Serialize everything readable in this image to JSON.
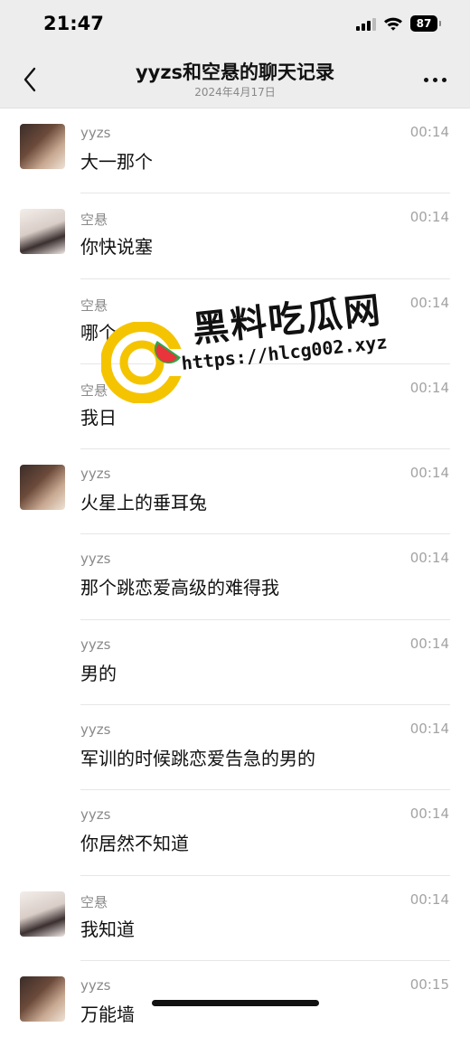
{
  "status": {
    "time": "21:47",
    "battery": "87"
  },
  "nav": {
    "title": "yyzs和空悬的聊天记录",
    "subtitle": "2024年4月17日"
  },
  "messages": [
    {
      "sender": "yyzs",
      "time": "00:14",
      "text": "大一那个",
      "avatar": "yyzs"
    },
    {
      "sender": "空悬",
      "time": "00:14",
      "text": "你快说塞",
      "avatar": "kongxuan"
    },
    {
      "sender": "空悬",
      "time": "00:14",
      "text": "哪个",
      "avatar": ""
    },
    {
      "sender": "空悬",
      "time": "00:14",
      "text": "我日",
      "avatar": ""
    },
    {
      "sender": "yyzs",
      "time": "00:14",
      "text": "火星上的垂耳兔",
      "avatar": "yyzs"
    },
    {
      "sender": "yyzs",
      "time": "00:14",
      "text": "那个跳恋爱高级的难得我",
      "avatar": ""
    },
    {
      "sender": "yyzs",
      "time": "00:14",
      "text": "男的",
      "avatar": ""
    },
    {
      "sender": "yyzs",
      "time": "00:14",
      "text": "军训的时候跳恋爱告急的男的",
      "avatar": ""
    },
    {
      "sender": "yyzs",
      "time": "00:14",
      "text": "你居然不知道",
      "avatar": ""
    },
    {
      "sender": "空悬",
      "time": "00:14",
      "text": "我知道",
      "avatar": "kongxuan"
    },
    {
      "sender": "yyzs",
      "time": "00:15",
      "text": "万能墙",
      "avatar": "yyzs"
    }
  ],
  "watermark": {
    "title": "黑料吃瓜网",
    "url": "https://hlcg002.xyz"
  },
  "colors": {
    "header_bg": "#ededed",
    "divider": "#e6e6e6",
    "timestamp": "#a3a3a3",
    "watermark_yellow": "#f5c400",
    "watermark_red": "#e8343a",
    "watermark_green": "#2aa84a"
  },
  "icons": {
    "back": "chevron-left-icon",
    "more": "more-dots-icon",
    "wifi": "wifi-icon",
    "signal": "signal-icon",
    "battery": "battery-icon"
  }
}
